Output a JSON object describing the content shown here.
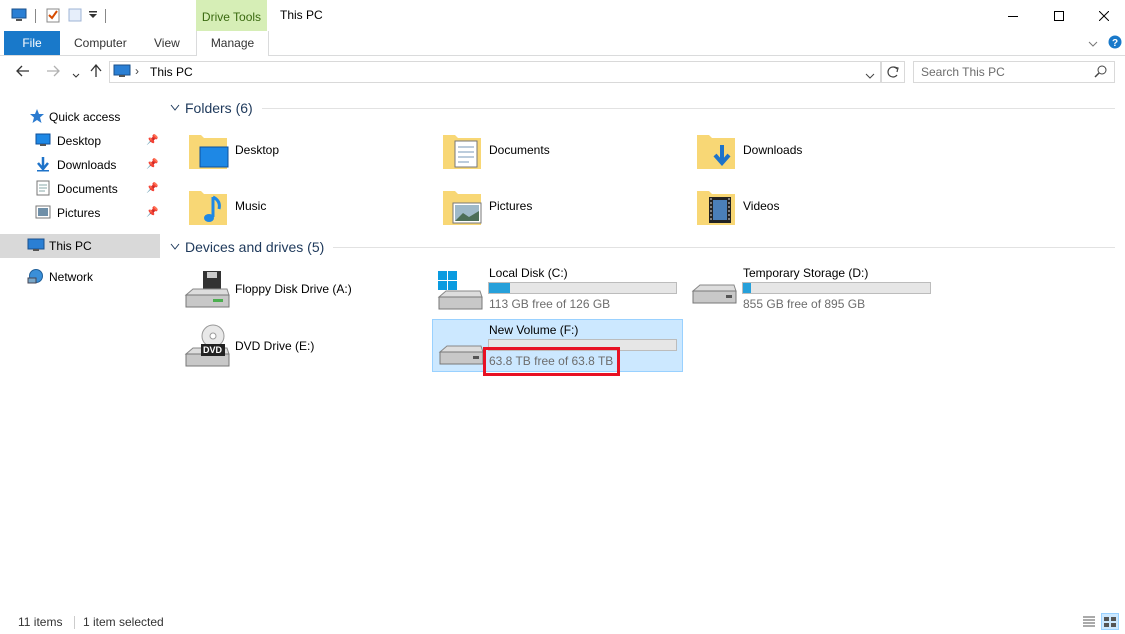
{
  "window": {
    "title": "This PC",
    "drive_tools": "Drive Tools"
  },
  "ribbon": {
    "tabs": [
      "File",
      "Computer",
      "View",
      "Manage"
    ]
  },
  "address": {
    "path": "This PC",
    "search_placeholder": "Search This PC"
  },
  "sidebar": {
    "quick_access": "Quick access",
    "items": [
      "Desktop",
      "Downloads",
      "Documents",
      "Pictures"
    ],
    "this_pc": "This PC",
    "network": "Network"
  },
  "folders": {
    "header": "Folders (6)",
    "items": [
      "Desktop",
      "Documents",
      "Downloads",
      "Music",
      "Pictures",
      "Videos"
    ]
  },
  "drives": {
    "header": "Devices and drives (5)",
    "items": [
      {
        "name": "Floppy Disk Drive (A:)"
      },
      {
        "name": "Local Disk (C:)",
        "free": "113 GB free of 126 GB",
        "used_fraction": 0.11
      },
      {
        "name": "Temporary Storage (D:)",
        "free": "855 GB free of 895 GB",
        "used_fraction": 0.045
      },
      {
        "name": "DVD Drive (E:)",
        "dvd_label": "DVD"
      },
      {
        "name": "New Volume (F:)",
        "free": "63.8 TB free of 63.8 TB",
        "used_fraction": 0.0
      }
    ]
  },
  "status": {
    "items": "11 items",
    "selected": "1 item selected"
  },
  "colors": {
    "accent": "#1979ca",
    "selection": "#cce8ff",
    "highlight_box": "#e81123",
    "bar_fill": "#26a0da"
  }
}
